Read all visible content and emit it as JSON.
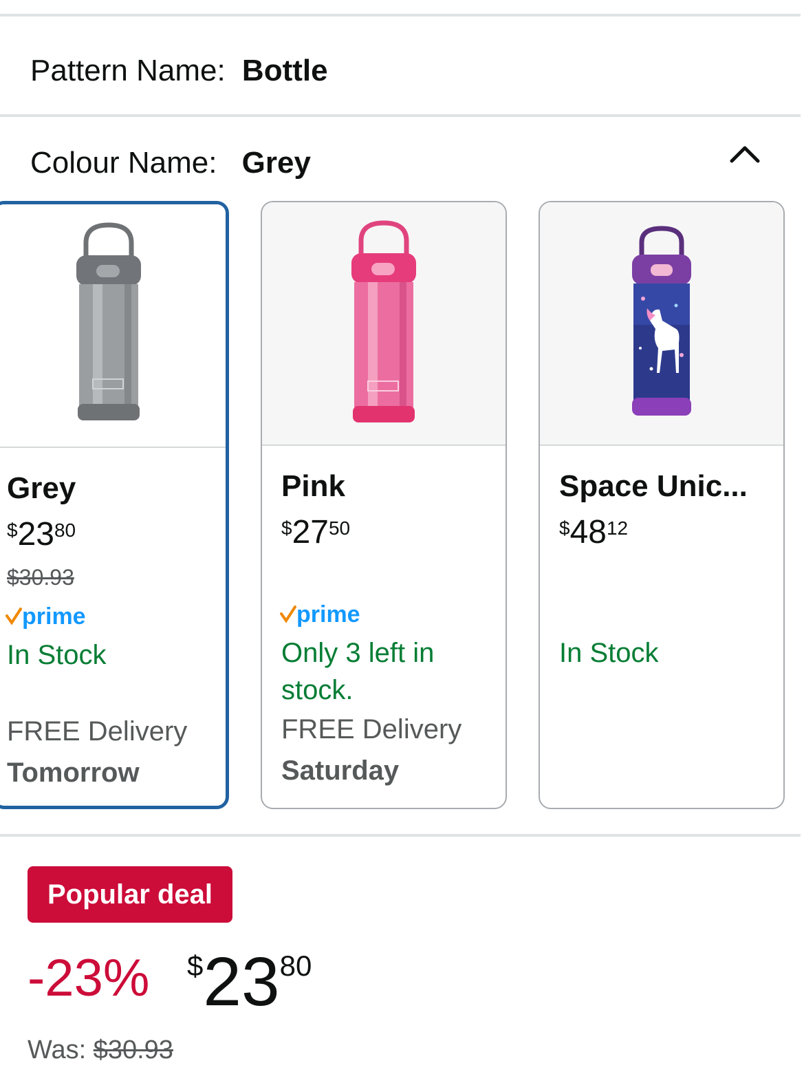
{
  "pattern": {
    "label": "Pattern Name:",
    "value": "Bottle"
  },
  "colour": {
    "label": "Colour Name:",
    "value": "Grey",
    "collapse_icon": "chevron-up-icon"
  },
  "colors": {
    "accent": "#2162a1",
    "instock": "#067d34",
    "deal": "#cc0c39",
    "prime": "#1399ff",
    "check": "#f08804"
  },
  "cards": [
    {
      "name": "Grey",
      "price_symbol": "$",
      "price_whole": "23",
      "price_fraction": "80",
      "was_price": "$30.93",
      "prime": "prime",
      "stock": "In Stock",
      "delivery": "FREE Delivery",
      "delivery_day": "Tomorrow",
      "selected": true,
      "image_color": "grey-bottle"
    },
    {
      "name": "Pink",
      "price_symbol": "$",
      "price_whole": "27",
      "price_fraction": "50",
      "prime": "prime",
      "stock": "Only 3 left in stock.",
      "delivery": "FREE Delivery",
      "delivery_day": "Saturday",
      "selected": false,
      "image_color": "pink-bottle"
    },
    {
      "name": "Space Unic...",
      "price_symbol": "$",
      "price_whole": "48",
      "price_fraction": "12",
      "stock": "In Stock",
      "selected": false,
      "image_color": "purple-unicorn-bottle"
    }
  ],
  "deal": {
    "badge": "Popular deal",
    "discount": "-23%",
    "price_symbol": "$",
    "price_whole": "23",
    "price_fraction": "80",
    "was_label": "Was:",
    "was_price": "$30.93"
  }
}
